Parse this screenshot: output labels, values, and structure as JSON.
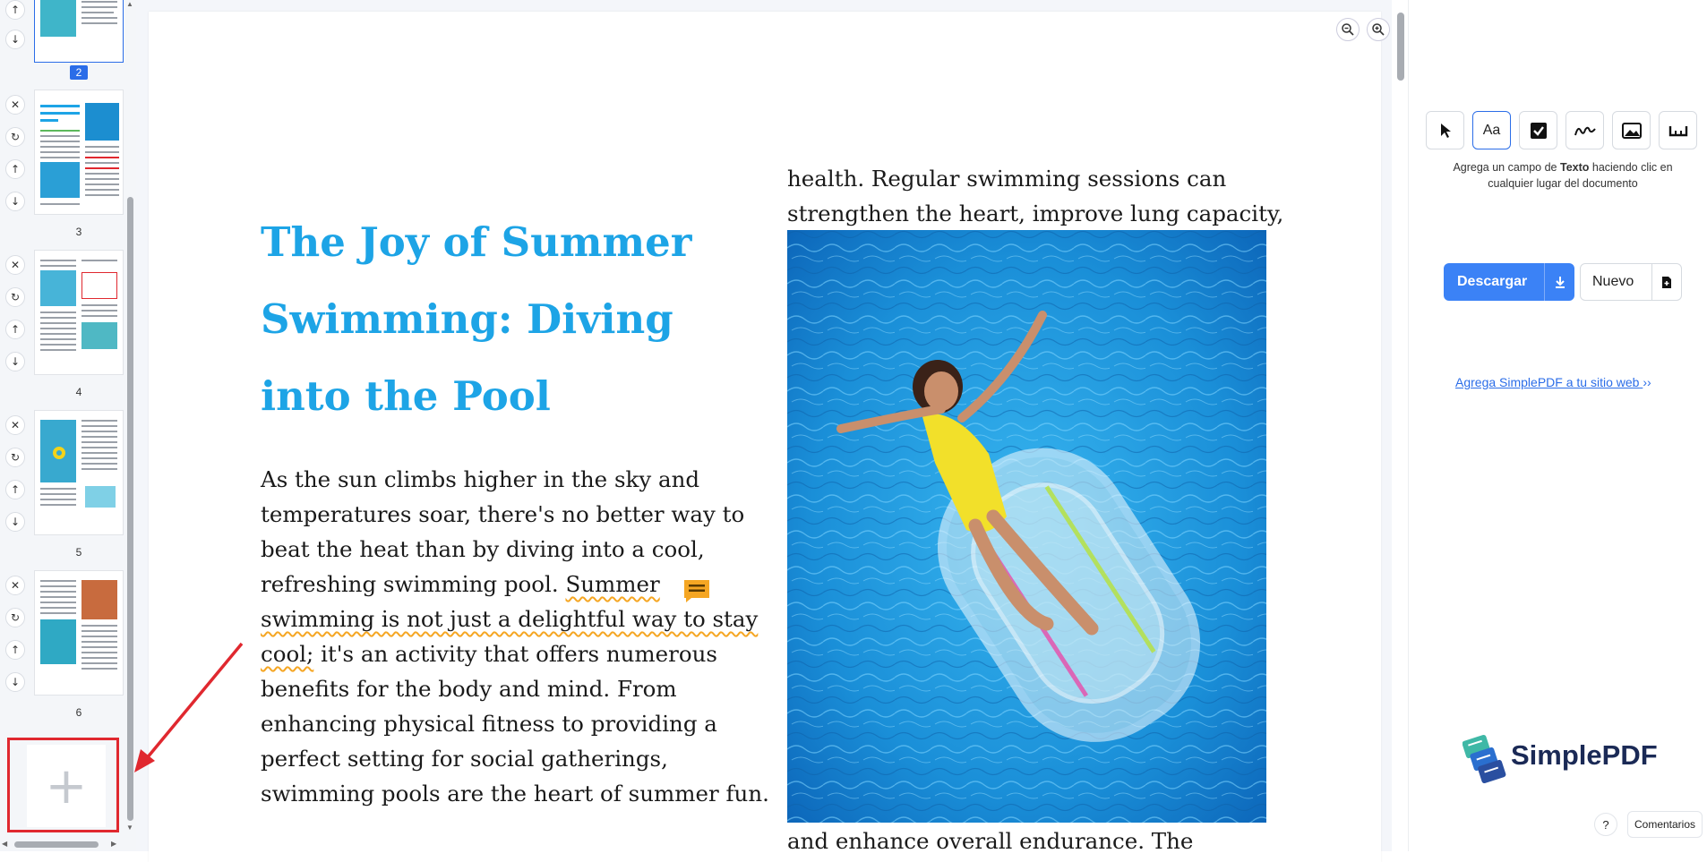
{
  "sidebar": {
    "pages": [
      {
        "number": "2",
        "active": true
      },
      {
        "number": "3",
        "active": false
      },
      {
        "number": "4",
        "active": false
      },
      {
        "number": "5",
        "active": false
      },
      {
        "number": "6",
        "active": false
      }
    ],
    "add_page_symbol": "+"
  },
  "document": {
    "title": "The Joy of Summer Swimming: Diving into the Pool",
    "paragraph_before_highlight": "As the sun climbs higher in the sky and temperatures soar, there's no better way to beat the heat than by diving into a cool, refreshing swimming pool.",
    "paragraph_highlight": "Summer swimming is not just a delightful way to stay cool;",
    "paragraph_after_highlight": "it's an activity that offers numerous benefits for the body and mind. From enhancing physical fitness to providing a perfect setting for social gatherings, swimming pools are the heart of summer fun.",
    "right_column_top": "health. Regular swimming sessions can strengthen the heart, improve lung capacity,",
    "right_column_bottom": "and enhance overall endurance. The",
    "image_alt": "woman-on-pool-float",
    "accent_color": "#1da4e6",
    "highlight_color": "#f5a623"
  },
  "toolbar": {
    "tools": [
      {
        "name": "select",
        "icon": "cursor-icon",
        "active": false
      },
      {
        "name": "text",
        "label": "Aa",
        "icon": "text-icon",
        "active": true
      },
      {
        "name": "checkbox",
        "icon": "checkbox-icon",
        "active": false
      },
      {
        "name": "signature",
        "icon": "signature-icon",
        "active": false
      },
      {
        "name": "image",
        "icon": "image-icon",
        "active": false
      },
      {
        "name": "extra",
        "icon": "ruler-icon",
        "active": false
      }
    ],
    "hint_prefix": "Agrega un campo de ",
    "hint_bold": "Texto",
    "hint_suffix": " haciendo clic en cualquier lugar del documento"
  },
  "actions": {
    "download_label": "Descargar",
    "new_label": "Nuevo",
    "embed_link": "Agrega SimplePDF a tu sitio web",
    "embed_chevron": "››",
    "primary_color": "#3b82f6"
  },
  "branding": {
    "logo_text": "SimplePDF"
  },
  "footer": {
    "help_label": "?",
    "feedback_label": "Comentarios"
  }
}
